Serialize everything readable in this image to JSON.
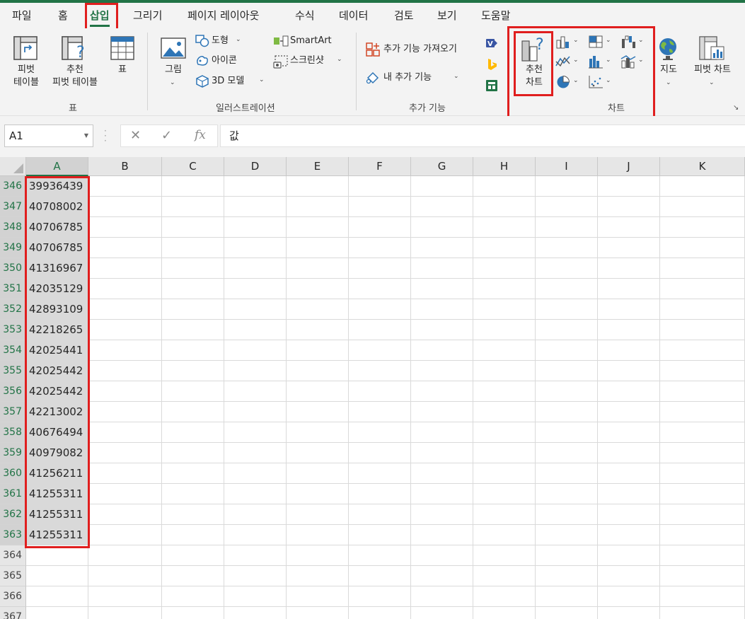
{
  "tabs": [
    "파일",
    "홈",
    "삽입",
    "그리기",
    "페이지 레이아웃",
    "수식",
    "데이터",
    "검토",
    "보기",
    "도움말"
  ],
  "active_tab": "삽입",
  "ribbon": {
    "table_group": {
      "label": "표",
      "pivot_table": [
        "피벗",
        "테이블"
      ],
      "recommended_pivot": [
        "추천",
        "피벗 테이블"
      ],
      "table": "표"
    },
    "illustrations_group": {
      "label": "일러스트레이션",
      "picture": "그림",
      "shapes": "도형",
      "icons": "아이콘",
      "models3d": "3D 모델",
      "smartart": "SmartArt",
      "screenshot": "스크린샷"
    },
    "addins_group": {
      "label": "추가 기능",
      "get_addins": "추가 기능 가져오기",
      "my_addins": "내 추가 기능"
    },
    "charts_group": {
      "label": "차트",
      "recommended_charts": [
        "추천",
        "차트"
      ],
      "maps": "지도",
      "pivot_chart": "피벗 차트"
    }
  },
  "formula_bar": {
    "name_box": "A1",
    "cancel_icon": "✕",
    "enter_icon": "✓",
    "fx": "fx",
    "content": "값"
  },
  "columns": [
    "A",
    "B",
    "C",
    "D",
    "E",
    "F",
    "G",
    "H",
    "I",
    "J",
    "K"
  ],
  "rows": [
    {
      "num": "346",
      "a": "39936439"
    },
    {
      "num": "347",
      "a": "40708002"
    },
    {
      "num": "348",
      "a": "40706785"
    },
    {
      "num": "349",
      "a": "40706785"
    },
    {
      "num": "350",
      "a": "41316967"
    },
    {
      "num": "351",
      "a": "42035129"
    },
    {
      "num": "352",
      "a": "42893109"
    },
    {
      "num": "353",
      "a": "42218265"
    },
    {
      "num": "354",
      "a": "42025441"
    },
    {
      "num": "355",
      "a": "42025442"
    },
    {
      "num": "356",
      "a": "42025442"
    },
    {
      "num": "357",
      "a": "42213002"
    },
    {
      "num": "358",
      "a": "40676494"
    },
    {
      "num": "359",
      "a": "40979082"
    },
    {
      "num": "360",
      "a": "41256211"
    },
    {
      "num": "361",
      "a": "41255311"
    },
    {
      "num": "362",
      "a": "41255311"
    },
    {
      "num": "363",
      "a": "41255311"
    },
    {
      "num": "364",
      "a": ""
    },
    {
      "num": "365",
      "a": ""
    },
    {
      "num": "366",
      "a": ""
    },
    {
      "num": "367",
      "a": ""
    }
  ],
  "colors": {
    "accent": "#217346",
    "highlight": "#e01e1e"
  }
}
